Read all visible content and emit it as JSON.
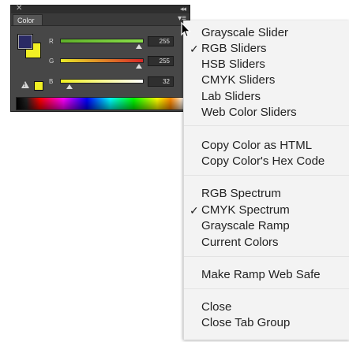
{
  "panel": {
    "tab_label": "Color",
    "close_glyph": "✕",
    "collapse_glyph": "◂◂",
    "menu_glyph": "▾≡",
    "foreground_color": "#2a2a64",
    "background_color": "#f2f024",
    "sliders": [
      {
        "label": "R",
        "value": "255",
        "color": "#7fd23a"
      },
      {
        "label": "G",
        "value": "255",
        "color": "#d83a3a"
      },
      {
        "label": "B",
        "value": "32",
        "color": "#e8e830"
      }
    ],
    "warning_glyph": "!"
  },
  "menu": {
    "sections": [
      [
        {
          "label": "Grayscale Slider",
          "checked": false
        },
        {
          "label": "RGB Sliders",
          "checked": true
        },
        {
          "label": "HSB Sliders",
          "checked": false
        },
        {
          "label": "CMYK Sliders",
          "checked": false
        },
        {
          "label": "Lab Sliders",
          "checked": false
        },
        {
          "label": "Web Color Sliders",
          "checked": false
        }
      ],
      [
        {
          "label": "Copy Color as HTML",
          "checked": false
        },
        {
          "label": "Copy Color's Hex Code",
          "checked": false
        }
      ],
      [
        {
          "label": "RGB Spectrum",
          "checked": false
        },
        {
          "label": "CMYK Spectrum",
          "checked": true
        },
        {
          "label": "Grayscale Ramp",
          "checked": false
        },
        {
          "label": "Current Colors",
          "checked": false
        }
      ],
      [
        {
          "label": "Make Ramp Web Safe",
          "checked": false
        }
      ],
      [
        {
          "label": "Close",
          "checked": false
        },
        {
          "label": "Close Tab Group",
          "checked": false
        }
      ]
    ],
    "check_glyph": "✓"
  }
}
